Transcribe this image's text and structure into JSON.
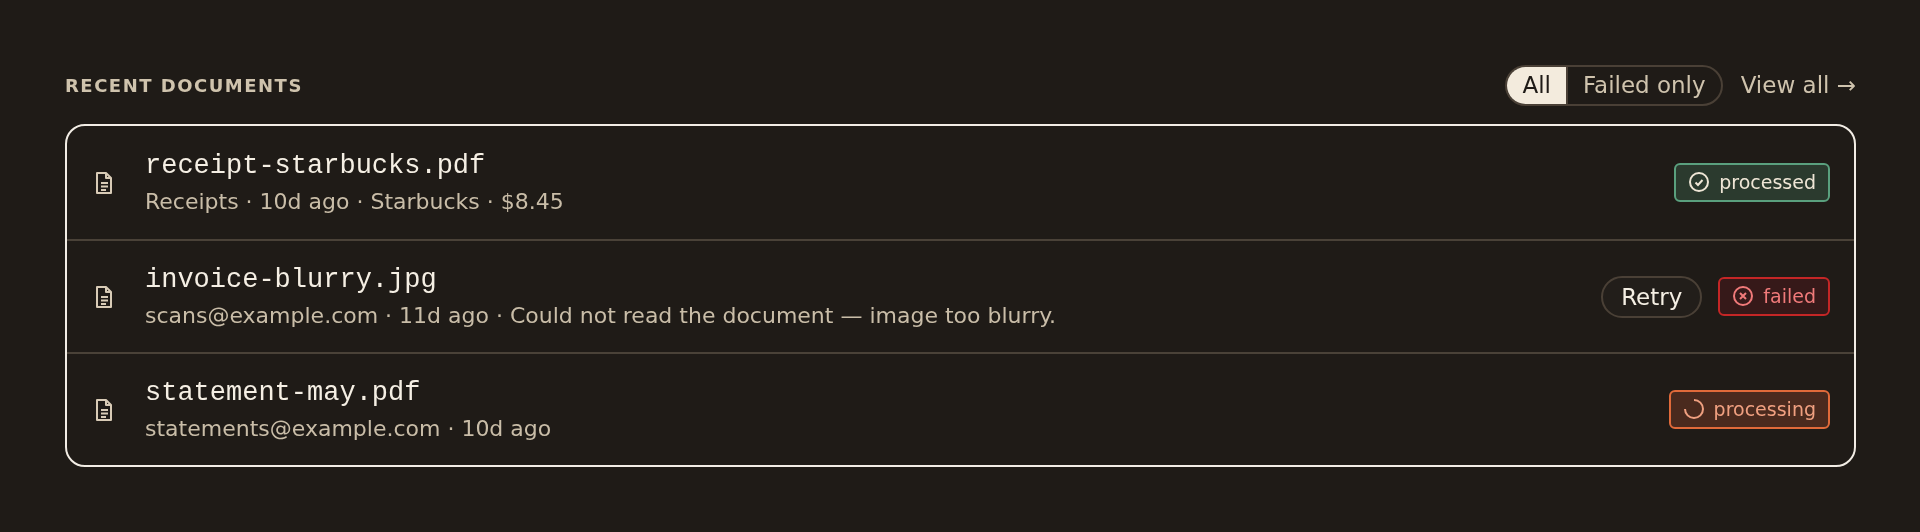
{
  "section": {
    "title": "RECENT DOCUMENTS"
  },
  "filters": [
    {
      "label": "All",
      "selected": true
    },
    {
      "label": "Failed only",
      "selected": false
    }
  ],
  "view_all": "View all →",
  "documents": [
    {
      "name": "receipt-starbucks.pdf",
      "meta": "Receipts · 10d ago · Starbucks · $8.45",
      "status": {
        "kind": "processed",
        "label": "processed"
      }
    },
    {
      "name": "invoice-blurry.jpg",
      "meta": "scans@example.com · 11d ago · Could not read the document — image too blurry.",
      "action": "Retry",
      "status": {
        "kind": "failed",
        "label": "failed"
      }
    },
    {
      "name": "statement-may.pdf",
      "meta": "statements@example.com · 10d ago",
      "status": {
        "kind": "processing",
        "label": "processing"
      }
    }
  ]
}
